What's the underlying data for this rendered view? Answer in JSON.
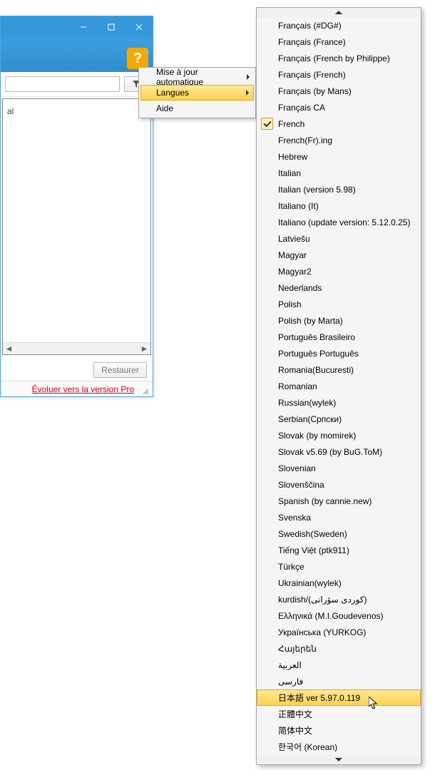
{
  "window": {
    "filter_placeholder": "",
    "content_label": "al",
    "restore_button": "Restaurer",
    "pro_link": "Évoluer vers la version Pro"
  },
  "context_menu": {
    "items": [
      {
        "label": "Mise à jour automatique",
        "has_submenu": true,
        "hover": false
      },
      {
        "label": "Langues",
        "has_submenu": true,
        "hover": true
      },
      {
        "label": "Aide",
        "has_submenu": false,
        "hover": false
      }
    ]
  },
  "languages": {
    "checked_index": 6,
    "hover_index": 41,
    "items": [
      "Français (#DG#)",
      "Français (France)",
      "Français (French by Philippe)",
      "Français (French)",
      "Français (by Mans)",
      "Français CA",
      "French",
      "French(Fr).ing",
      "Hebrew",
      "Italian",
      "Italian (version 5.98)",
      "Italiano (It)",
      "Italiano (update version: 5.12.0.25)",
      "Latviešu",
      "Magyar",
      "Magyar2",
      "Nederlands",
      "Polish",
      "Polish (by Marta)",
      "Português Brasileiro",
      "Português Português",
      "Romania(Bucuresti)",
      "Romanian",
      "Russian(wylek)",
      "Serbian(Српски)",
      "Slovak (by momirek)",
      "Slovak v5.69 (by BuG.ToM)",
      "Slovenian",
      "Slovenščina",
      "Spanish (by cannie.new)",
      "Svenska",
      "Swedish(Sweden)",
      "Tiếng Việt (ptk911)",
      "Türkçe",
      "Ukrainian(wylek)",
      "kurdish/(کوردی سۆرانی)",
      "Ελληνικά (M.I.Goudevenos)",
      "Українська (YURKOG)",
      "Հայերեն",
      "العربية",
      "فارسی",
      "日本語 ver 5.97.0.119",
      "正體中文",
      "简体中文",
      "한국어 (Korean)"
    ]
  }
}
